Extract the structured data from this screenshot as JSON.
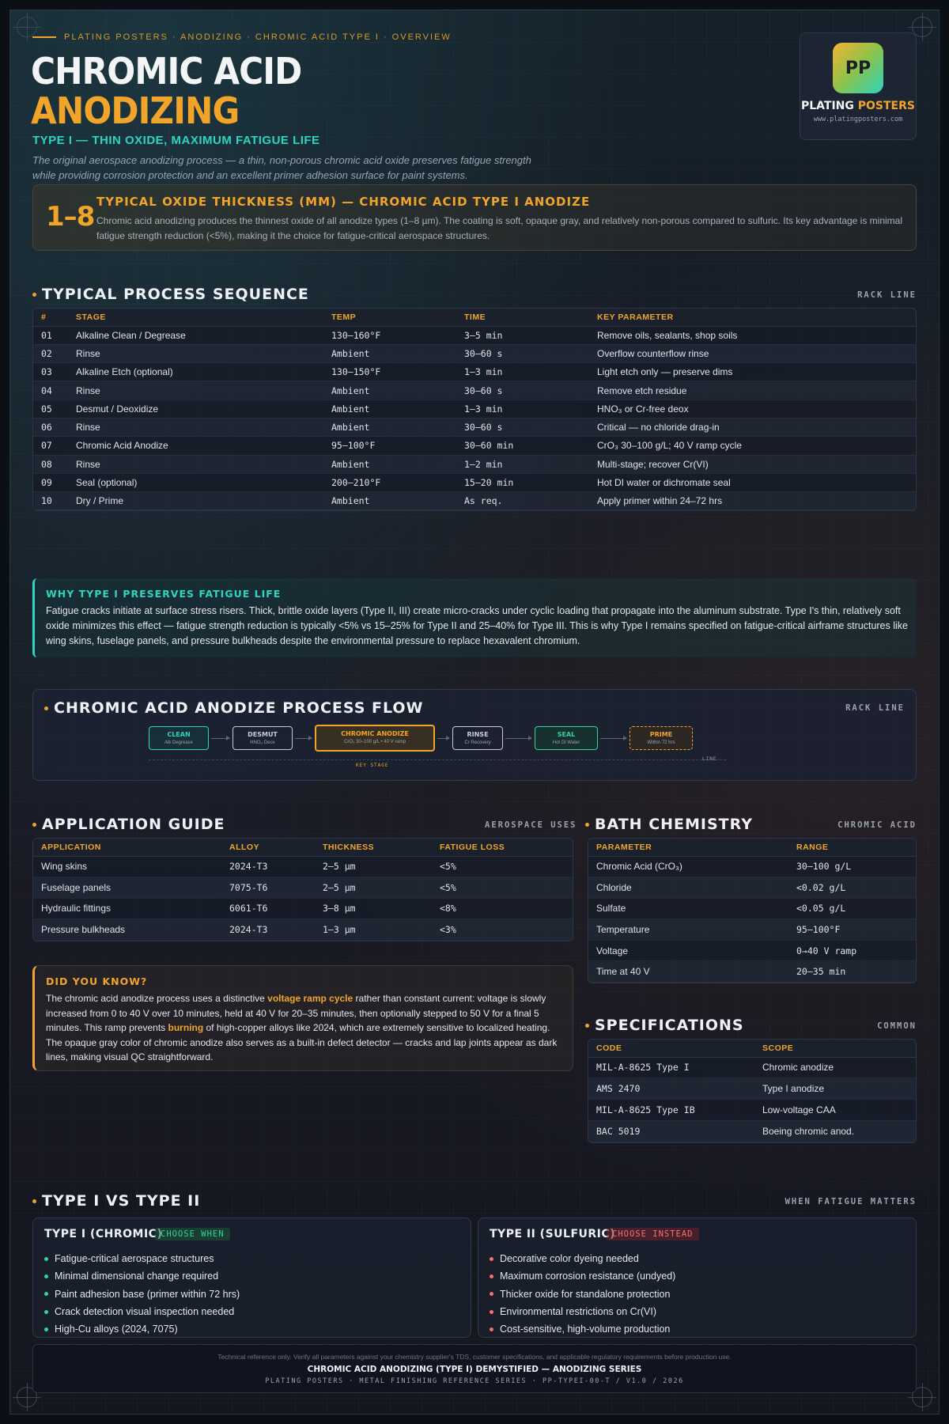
{
  "header": {
    "breadcrumb": "PLATING POSTERS · ANODIZING · CHROMIC ACID TYPE I · OVERVIEW",
    "title_line1": "CHROMIC ACID",
    "title_line2": "ANODIZING",
    "subtitle": "TYPE I — THIN OXIDE, MAXIMUM FATIGUE LIFE",
    "lede_line1": "The original aerospace anodizing process — a thin, non-porous chromic acid oxide preserves fatigue strength",
    "lede_line2": "while providing corrosion protection and an excellent primer adhesion surface for paint systems."
  },
  "logo": {
    "mark": "PP",
    "name_a": "PLATING",
    "name_b": "POSTERS",
    "url": "www.platingposters.com"
  },
  "callout": {
    "big": "1–8",
    "head": "TYPICAL OXIDE THICKNESS (MM) — CHROMIC ACID TYPE I ANODIZE",
    "body": "Chromic acid anodizing produces the thinnest oxide of all anodize types (1–8 µm). The coating is soft, opaque gray, and relatively non-porous compared to sulfuric. Its key advantage is minimal fatigue strength reduction (<5%), making it the choice for fatigue-critical aerospace structures."
  },
  "process": {
    "title": "TYPICAL PROCESS SEQUENCE",
    "tag": "RACK LINE",
    "columns": [
      "#",
      "STAGE",
      "TEMP",
      "TIME",
      "KEY PARAMETER"
    ],
    "rows": [
      [
        "01",
        "Alkaline Clean / Degrease",
        "130–160°F",
        "3–5 min",
        "Remove oils, sealants, shop soils"
      ],
      [
        "02",
        "Rinse",
        "Ambient",
        "30–60 s",
        "Overflow counterflow rinse"
      ],
      [
        "03",
        "Alkaline Etch (optional)",
        "130–150°F",
        "1–3 min",
        "Light etch only — preserve dims"
      ],
      [
        "04",
        "Rinse",
        "Ambient",
        "30–60 s",
        "Remove etch residue"
      ],
      [
        "05",
        "Desmut / Deoxidize",
        "Ambient",
        "1–3 min",
        "HNO₃ or Cr-free deox"
      ],
      [
        "06",
        "Rinse",
        "Ambient",
        "30–60 s",
        "Critical — no chloride drag-in"
      ],
      [
        "07",
        "Chromic Acid Anodize",
        "95–100°F",
        "30–60 min",
        "CrO₃ 30–100 g/L; 40 V ramp cycle"
      ],
      [
        "08",
        "Rinse",
        "Ambient",
        "1–2 min",
        "Multi-stage; recover Cr(VI)"
      ],
      [
        "09",
        "Seal (optional)",
        "200–210°F",
        "15–20 min",
        "Hot DI water or dichromate seal"
      ],
      [
        "10",
        "Dry / Prime",
        "Ambient",
        "As req.",
        "Apply primer within 24–72 hrs"
      ]
    ]
  },
  "why": {
    "head": "WHY TYPE I PRESERVES FATIGUE LIFE",
    "body": "Fatigue cracks initiate at surface stress risers. Thick, brittle oxide layers (Type II, III) create micro-cracks under cyclic loading that propagate into the aluminum substrate. Type I's thin, relatively soft oxide minimizes this effect — fatigue strength reduction is typically <5% vs 15–25% for Type II and 25–40% for Type III. This is why Type I remains specified on fatigue-critical airframe structures like wing skins, fuselage panels, and pressure bulkheads despite the environmental pressure to replace hexavalent chromium."
  },
  "flow": {
    "title": "CHROMIC ACID ANODIZE PROCESS FLOW",
    "tag": "RACK LINE",
    "steps": [
      {
        "label": "CLEAN",
        "sub": "Alk Degrease",
        "color": "#2dd4bf"
      },
      {
        "label": "DESMUT",
        "sub": "HNO₃ Deox",
        "color": "#c7ccd4"
      },
      {
        "label": "CHROMIC ANODIZE",
        "sub": "CrO₃ 30–100 g/L • 40 V ramp",
        "color": "#f0a52a"
      },
      {
        "label": "RINSE",
        "sub": "Cr Recovery",
        "color": "#c7ccd4"
      },
      {
        "label": "SEAL",
        "sub": "Hot DI Water",
        "color": "#34d399"
      },
      {
        "label": "PRIME",
        "sub": "Within 72 hrs",
        "color": "#f0a52a"
      }
    ],
    "key_stage": "KEY STAGE",
    "line_label": "LINE"
  },
  "applications": {
    "title": "APPLICATION GUIDE",
    "tag": "AEROSPACE USES",
    "columns": [
      "APPLICATION",
      "ALLOY",
      "THICKNESS",
      "FATIGUE LOSS"
    ],
    "rows": [
      [
        "Wing skins",
        "2024-T3",
        "2–5 µm",
        "<5%"
      ],
      [
        "Fuselage panels",
        "7075-T6",
        "2–5 µm",
        "<5%"
      ],
      [
        "Hydraulic fittings",
        "6061-T6",
        "3–8 µm",
        "<8%"
      ],
      [
        "Pressure bulkheads",
        "2024-T3",
        "1–3 µm",
        "<3%"
      ]
    ]
  },
  "bath": {
    "title": "BATH CHEMISTRY",
    "tag": "CHROMIC ACID",
    "columns": [
      "PARAMETER",
      "RANGE"
    ],
    "rows": [
      [
        "Chromic Acid (CrO₃)",
        "30–100 g/L"
      ],
      [
        "Chloride",
        "<0.02 g/L"
      ],
      [
        "Sulfate",
        "<0.05 g/L"
      ],
      [
        "Temperature",
        "95–100°F"
      ],
      [
        "Voltage",
        "0→40 V ramp"
      ],
      [
        "Time at 40 V",
        "20–35 min"
      ]
    ]
  },
  "did_you_know": {
    "head": "DID YOU KNOW?",
    "t1": "The chromic acid anodize process uses a distinctive ",
    "h1": "voltage ramp cycle",
    "t2": " rather than constant current: voltage is slowly increased from 0 to 40 V over 10 minutes, held at 40 V for 20–35 minutes, then optionally stepped to 50 V for a final 5 minutes. This ramp prevents ",
    "h2": "burning",
    "t3": " of high-copper alloys like 2024, which are extremely sensitive to localized heating. The opaque gray color of chromic anodize also serves as a built-in defect detector — cracks and lap joints appear as dark lines, making visual QC straightforward."
  },
  "specs": {
    "title": "SPECIFICATIONS",
    "tag": "COMMON",
    "columns": [
      "CODE",
      "SCOPE"
    ],
    "rows": [
      [
        "MIL-A-8625 Type I",
        "Chromic anodize"
      ],
      [
        "AMS 2470",
        "Type I anodize"
      ],
      [
        "MIL-A-8625 Type IB",
        "Low-voltage CAA"
      ],
      [
        "BAC 5019",
        "Boeing chromic anod."
      ]
    ]
  },
  "compare": {
    "title": "TYPE I VS TYPE II",
    "tag": "WHEN FATIGUE MATTERS",
    "type1": {
      "head": "TYPE I (CHROMIC)",
      "badge": "CHOOSE WHEN",
      "items": [
        "Fatigue-critical aerospace structures",
        "Minimal dimensional change required",
        "Paint adhesion base (primer within 72 hrs)",
        "Crack detection visual inspection needed",
        "High-Cu alloys (2024, 7075)"
      ]
    },
    "type2": {
      "head": "TYPE II (SULFURIC)",
      "badge": "CHOOSE INSTEAD",
      "items": [
        "Decorative color dyeing needed",
        "Maximum corrosion resistance (undyed)",
        "Thicker oxide for standalone protection",
        "Environmental restrictions on Cr(VI)",
        "Cost-sensitive, high-volume production"
      ]
    }
  },
  "footer": {
    "disclaimer": "Technical reference only. Verify all parameters against your chemistry supplier's TDS, customer specifications, and applicable regulatory requirements before production use.",
    "series": "CHROMIC ACID ANODIZING (TYPE I) DEMYSTIFIED — ANODIZING SERIES",
    "meta": "PLATING POSTERS · METAL FINISHING REFERENCE SERIES · PP-TYPEI-00-T / V1.0 / 2026"
  },
  "colors": {
    "accent": "#f0a52a",
    "teal": "#2dd4bf",
    "green": "#34d399",
    "red": "#f47272"
  }
}
